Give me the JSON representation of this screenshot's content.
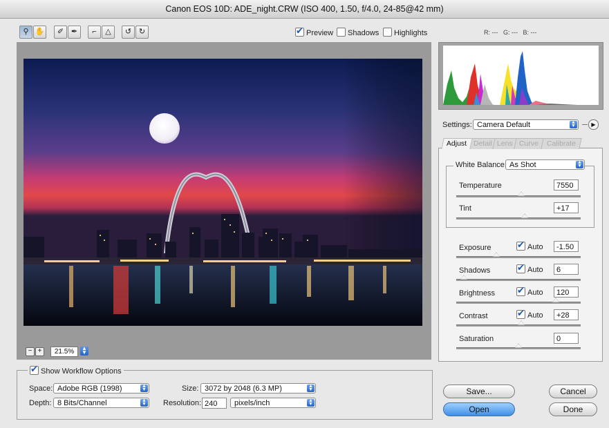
{
  "window": {
    "title": "Canon EOS 10D:  ADE_night.CRW  (ISO 400, 1.50, f/4.0, 24-85@42 mm)"
  },
  "tools": [
    {
      "icon": "zoom-icon",
      "glyph": "⚲"
    },
    {
      "icon": "hand-icon",
      "glyph": "✋"
    },
    {
      "icon": "white-balance-eyedropper-icon",
      "glyph": "✐"
    },
    {
      "icon": "color-sampler-icon",
      "glyph": "✒"
    },
    {
      "icon": "crop-icon",
      "glyph": "⌐"
    },
    {
      "icon": "straighten-icon",
      "glyph": "△"
    },
    {
      "icon": "rotate-left-icon",
      "glyph": "↺"
    },
    {
      "icon": "rotate-right-icon",
      "glyph": "↻"
    }
  ],
  "view_options": {
    "preview": {
      "label": "Preview",
      "checked": true
    },
    "shadows": {
      "label": "Shadows",
      "checked": false
    },
    "highlights": {
      "label": "Highlights",
      "checked": false
    }
  },
  "rgb_readout": {
    "r": "R: ---",
    "g": "G: ---",
    "b": "B: ---"
  },
  "zoom": {
    "minus": "−",
    "plus": "+",
    "value": "21.5%"
  },
  "settings": {
    "label": "Settings:",
    "value": "Camera Default"
  },
  "tabs": [
    {
      "label": "Adjust",
      "active": true
    },
    {
      "label": "Detail",
      "active": false
    },
    {
      "label": "Lens",
      "active": false
    },
    {
      "label": "Curve",
      "active": false
    },
    {
      "label": "Calibrate",
      "active": false
    }
  ],
  "white_balance": {
    "label": "White Balance:",
    "value": "As Shot"
  },
  "adjust": {
    "temperature": {
      "label": "Temperature",
      "value": "7550",
      "position": 0.52
    },
    "tint": {
      "label": "Tint",
      "value": "+17",
      "position": 0.55
    },
    "exposure": {
      "label": "Exposure",
      "auto": "Auto",
      "auto_checked": true,
      "value": "-1.50",
      "position": 0.32
    },
    "shadows": {
      "label": "Shadows",
      "auto": "Auto",
      "auto_checked": true,
      "value": "6",
      "position": 0.06
    },
    "brightness": {
      "label": "Brightness",
      "auto": "Auto",
      "auto_checked": true,
      "value": "120",
      "position": 0.8
    },
    "contrast": {
      "label": "Contrast",
      "auto": "Auto",
      "auto_checked": true,
      "value": "+28",
      "position": 0.52
    },
    "saturation": {
      "label": "Saturation",
      "value": "0",
      "position": 0.5
    }
  },
  "workflow": {
    "toggle_label": "Show Workflow Options",
    "space": {
      "label": "Space:",
      "value": "Adobe RGB (1998)"
    },
    "depth": {
      "label": "Depth:",
      "value": "8 Bits/Channel"
    },
    "size": {
      "label": "Size:",
      "value": "3072 by 2048  (6.3 MP)"
    },
    "resolution": {
      "label": "Resolution:",
      "value": "240",
      "unit": "pixels/inch"
    }
  },
  "buttons": {
    "save": "Save...",
    "cancel": "Cancel",
    "open": "Open",
    "done": "Done"
  },
  "colors": {
    "accent": "#2764c8",
    "default_button": "#3f8fe6",
    "panel_gray": "#9a9a9a"
  }
}
